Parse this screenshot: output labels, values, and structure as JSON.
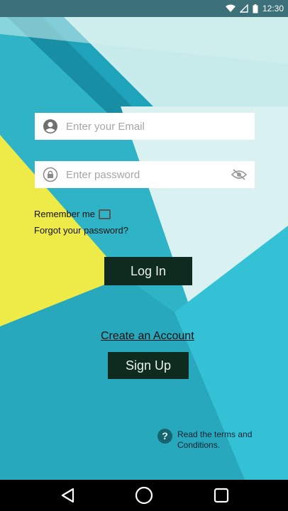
{
  "status_bar": {
    "time": "12:30",
    "icons": [
      "wifi-icon",
      "signal-icon",
      "battery-icon"
    ]
  },
  "login_form": {
    "email_placeholder": "Enter your Email",
    "email_value": "",
    "password_placeholder": "Enter password",
    "password_value": "",
    "remember_label": "Remember me",
    "remember_checked": false,
    "forgot_label": "Forgot your password?",
    "login_label": "Log In",
    "create_account_label": "Create an Account",
    "signup_label": "Sign Up"
  },
  "terms": {
    "line1": "Read the terms and",
    "line2": "Conditions."
  },
  "nav_bar": {
    "buttons": [
      "back-icon",
      "home-icon",
      "recents-icon"
    ]
  },
  "colors": {
    "button_bg": "#0f2a1e",
    "background_teal": "#2bb3c6",
    "accent_yellow": "#efe94b",
    "light_cyan": "#c9ecec"
  }
}
